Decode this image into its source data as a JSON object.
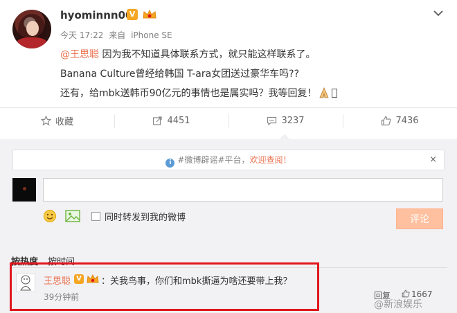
{
  "post": {
    "username": "hyominnn00",
    "verified_badge": "V",
    "time": "今天 17:22",
    "source_prefix": "来自",
    "source": "iPhone SE",
    "line1_mention": "@王思聪",
    "line1_text": " 因为我不知道具体联系方式，就只能这样联系了。",
    "line2_text": "Banana Culture曾经给韩国 T-ara女团送过豪华车吗??",
    "line3_text": "还有，给mbk送韩币90亿元的事情也是属实吗？我等回复！"
  },
  "actions": {
    "favorite": "收藏",
    "repost": "4451",
    "comment": "3237",
    "like": "7436"
  },
  "comment_panel": {
    "rumor_hashtag": "#微博辟谣#平台，",
    "rumor_welcome": "欢迎查阅！",
    "rumor_close": "×",
    "sync_label": "同时转发到我的微博",
    "submit_label": "评论",
    "sort_hot": "按热度",
    "sort_time": "按时间"
  },
  "top_comment": {
    "author": "王思聪",
    "verified_badge": "V",
    "text": "：关我鸟事，你们和mbk撕逼为啥还要带上我？",
    "time": "39分钟前",
    "reply_label": "回复",
    "likes": "1667"
  },
  "watermark": "@新浪娱乐",
  "colors": {
    "accent": "#eb7350",
    "highlight_border": "#e0161c",
    "badge": "#f5a623",
    "submit_disabled": "#ffc09f"
  },
  "icons": [
    "chevron-down-icon",
    "star-icon",
    "repost-icon",
    "comment-icon",
    "thumbs-up-icon",
    "info-icon",
    "emoji-icon",
    "image-icon",
    "crown-icon",
    "pray-icon"
  ]
}
